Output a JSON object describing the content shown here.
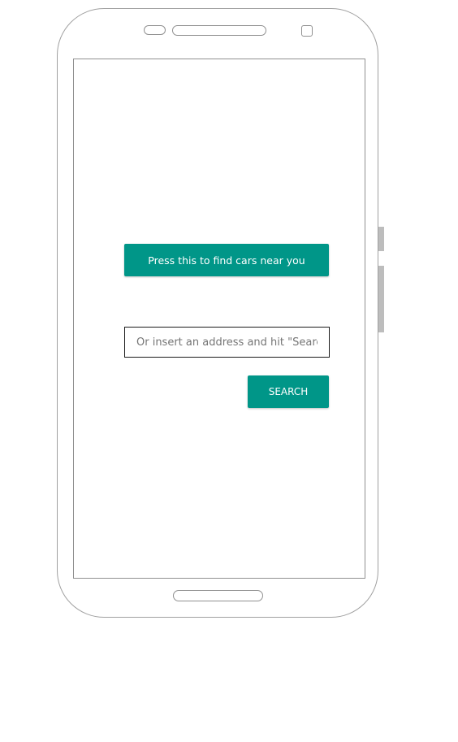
{
  "colors": {
    "accent": "#009688",
    "button_text": "#ffffff",
    "frame": "#a0a0a0",
    "side_buttons": "#bdbdbd"
  },
  "main": {
    "find_cars_button_label": "Press this to find cars near you",
    "address_input": {
      "value": "",
      "placeholder": "Or insert an address and hit \"Search\""
    },
    "search_button_label": "SEARCH"
  }
}
